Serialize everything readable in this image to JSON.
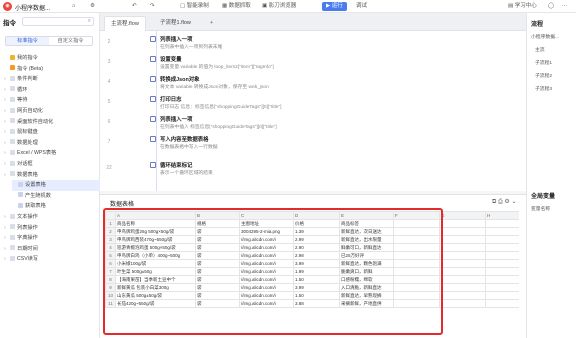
{
  "titlebar": {
    "app_name": "小程序数据...",
    "undo": "↶",
    "redo": "↷",
    "smart_record": "智能录制",
    "data_capture": "数据抓取",
    "browser": "影刀浏览器",
    "run_label": "运行",
    "debug_label": "调试",
    "learning_center": "学习中心"
  },
  "left_panel": {
    "title": "指令",
    "tabs": [
      "标准指令",
      "自定义指令"
    ],
    "items": [
      {
        "label": "我的指令",
        "icon_color": "#f0b429",
        "type": "item"
      },
      {
        "label": "指令 (Beta)",
        "icon_color": "#f59a23",
        "type": "item"
      },
      {
        "label": "条件判断",
        "type": "group"
      },
      {
        "label": "循环",
        "type": "group"
      },
      {
        "label": "等待",
        "type": "group"
      },
      {
        "label": "网页自动化",
        "type": "group"
      },
      {
        "label": "桌面软件自动化",
        "type": "group"
      },
      {
        "label": "鼠标键盘",
        "type": "group"
      },
      {
        "label": "数据处理",
        "type": "group"
      },
      {
        "label": "Excel / WPS表格",
        "type": "group"
      },
      {
        "label": "对话框",
        "type": "group"
      },
      {
        "label": "数据表格",
        "type": "group"
      },
      {
        "label": "设置表格",
        "type": "sub",
        "selected": true
      },
      {
        "label": "产生随机数",
        "type": "sub"
      },
      {
        "label": "获取表格",
        "type": "sub"
      },
      {
        "label": "文本操作",
        "type": "group"
      },
      {
        "label": "列表操作",
        "type": "group"
      },
      {
        "label": "字典操作",
        "type": "group"
      },
      {
        "label": "日期时间",
        "type": "group"
      },
      {
        "label": "CSV读写",
        "type": "group"
      }
    ]
  },
  "tabs": [
    {
      "label": "主流程.flow",
      "active": true
    },
    {
      "label": "子流程1.flow",
      "active": false
    }
  ],
  "tab_add": "+",
  "flow_rows": [
    {
      "num": "2",
      "title": "列表插入一项",
      "desc": "在列表中插入一项到列表末尾"
    },
    {
      "num": "3",
      "title": "设置变量",
      "desc": "设置变量 variable 的值为 loop_item2[\"item\"][\"tagInfo\"]"
    },
    {
      "num": "4",
      "title": "转换成Json对象",
      "desc": "将文本 variable 转换成Json对象，保存至 web_json"
    },
    {
      "num": "5",
      "title": "打印日志",
      "desc": "打印日志 信息：标签信息[\"shoppingGuideTags\"][0][\"title\"]"
    },
    {
      "num": "6",
      "title": "列表插入一项",
      "desc": "在列表中插入 标签信息[\"shoppingGuideTags\"][0][\"title\"]"
    },
    {
      "num": "7",
      "title": "写入内容至数据表格",
      "desc": "在数据表格中写入一行数据"
    },
    {
      "num": "22",
      "title": "循环结束标记",
      "desc": "表示一个循环区域的结束"
    }
  ],
  "right_panel": {
    "flow_title": "流程",
    "flow_items": [
      "小程序数据...",
      "主流",
      "子流程1",
      "子流程2",
      "子流程3"
    ],
    "vars_title": "全局变量",
    "vars_col": "变量名称"
  },
  "data_table": {
    "title": "数据表格",
    "toolbar": "⧉ ⎙ ⚙ ⌄",
    "columns": [
      "",
      "A",
      "B",
      "C",
      "D",
      "E",
      "F",
      "G",
      "H"
    ],
    "rows": [
      [
        "1",
        "商品名称",
        "规格",
        "主图地址",
        "价格",
        "商品标签",
        "",
        "",
        ""
      ],
      [
        "2",
        "申鸟牌鸡蛋26g 500g×50g/袋",
        "袋",
        "3004295-2-mia.png",
        "1.39",
        "新鲜直达，次日送达",
        "",
        "",
        ""
      ],
      [
        "3",
        "申鸟牌鸡西装470g~550g/袋",
        "袋",
        "//img.alicdn.com/i",
        "2.99",
        "新鲜直达，出水限量",
        "",
        "",
        ""
      ],
      [
        "4",
        "巡游青椒泡鸡蛋 500g×50g/袋",
        "袋",
        "//img.alicdn.com/i",
        "2.90",
        "鲜嫩可口，新鲜直达",
        "",
        "",
        ""
      ],
      [
        "5",
        "申鸟牌白鸡（小单）400g~500g",
        "袋",
        "//img.alicdn.com/i",
        "2.98",
        "已25万好评",
        "",
        "",
        ""
      ],
      [
        "6",
        "小米椒100g/袋",
        "袋",
        "//img.alicdn.com/i",
        "3.99",
        "新鲜直达，颗色饱满",
        "",
        "",
        ""
      ],
      [
        "7",
        "叶生菜 500g±50g",
        "袋",
        "//img.alicdn.com/i",
        "1.99",
        "脆嫩爽口，新鲜",
        "",
        "",
        ""
      ],
      [
        "8",
        "【海南果苗】当季新土豆中个",
        "袋",
        "//img.alicdn.com/i",
        "1.50",
        "口感粉糯，绵软",
        "",
        "",
        ""
      ],
      [
        "9",
        "新鲜黄瓜 包装小白菜300g",
        "袋",
        "//img.alicdn.com/i",
        "3.99",
        "入口清脆，新鲜直达",
        "",
        "",
        ""
      ],
      [
        "10",
        "山东黄瓜 500g±50g/袋",
        "袋",
        "//img.alicdn.com/i",
        "1.50",
        "新鲜直达，早熟现摘",
        "",
        "",
        ""
      ],
      [
        "11",
        "长茄420g~550g/袋",
        "袋",
        "//img.alicdn.com/i",
        "3.88",
        "采摘新鲜，产地直供",
        "",
        "",
        ""
      ]
    ]
  }
}
